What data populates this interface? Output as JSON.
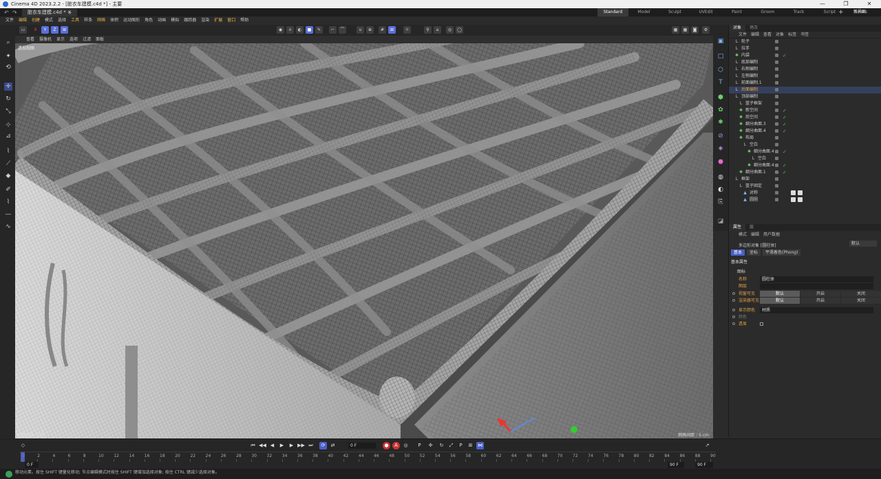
{
  "window": {
    "title": "Cinema 4D 2023.2.2 - [脏衣车建模.c4d *] - 主要"
  },
  "doc_tab": {
    "label": "脏衣车建模.c4d *"
  },
  "layouts": [
    {
      "label": "Standard",
      "active": true
    },
    {
      "label": "Model"
    },
    {
      "label": "Sculpt"
    },
    {
      "label": "UVEdit"
    },
    {
      "label": "Paint"
    },
    {
      "label": "Groom"
    },
    {
      "label": "Track"
    },
    {
      "label": "Script"
    },
    {
      "label": "Nodes"
    }
  ],
  "new_interface": "新界面",
  "menu": [
    "文件",
    "编辑",
    "创建",
    "模式",
    "选择",
    "工具",
    "样条",
    "网格",
    "体积",
    "运动图形",
    "角色",
    "动画",
    "模拟",
    "跟踪器",
    "渲染",
    "扩展",
    "窗口",
    "帮助"
  ],
  "viewport": {
    "menu": [
      "查看",
      "摄像机",
      "显示",
      "选项",
      "过滤",
      "面板"
    ],
    "name": "透视视图",
    "status_left": "查看变换: 工程",
    "status_right": "网格间距 : 5 cm"
  },
  "object_manager": {
    "tabs": [
      "对象",
      "场次"
    ],
    "menu": [
      "文件",
      "编辑",
      "查看",
      "对象",
      "标签",
      "书签"
    ],
    "objects": [
      {
        "name": "轮子",
        "indent": 0,
        "icon": "null"
      },
      {
        "name": "拉手",
        "indent": 0,
        "icon": "null"
      },
      {
        "name": "内袋",
        "indent": 0,
        "icon": "gen",
        "check": true
      },
      {
        "name": "底部编制",
        "indent": 0,
        "icon": "null"
      },
      {
        "name": "右侧编制",
        "indent": 0,
        "icon": "null"
      },
      {
        "name": "左侧编制",
        "indent": 0,
        "icon": "null"
      },
      {
        "name": "前面编制.1",
        "indent": 0,
        "icon": "null"
      },
      {
        "name": "后面编制",
        "indent": 0,
        "icon": "null",
        "highlight": true
      },
      {
        "name": "顶部编制",
        "indent": 0,
        "icon": "null"
      },
      {
        "name": "篮子框架",
        "indent": 1,
        "icon": "null"
      },
      {
        "name": "新空间",
        "indent": 1,
        "icon": "gen",
        "check": true
      },
      {
        "name": "后空间",
        "indent": 1,
        "icon": "gen",
        "check": true
      },
      {
        "name": "细分曲面.3",
        "indent": 1,
        "icon": "gen",
        "check": true
      },
      {
        "name": "细分曲面.4",
        "indent": 1,
        "icon": "gen",
        "check": true
      },
      {
        "name": "布局",
        "indent": 1,
        "icon": "gen"
      },
      {
        "name": "空白",
        "indent": 2,
        "icon": "null"
      },
      {
        "name": "细分曲面.4",
        "indent": 3,
        "icon": "gen",
        "check": true
      },
      {
        "name": "空白",
        "indent": 4,
        "icon": "null"
      },
      {
        "name": "细分曲面.4",
        "indent": 3,
        "icon": "gen",
        "check": true
      },
      {
        "name": "细分曲面.1",
        "indent": 1,
        "icon": "gen",
        "check": true
      },
      {
        "name": "框架",
        "indent": 0,
        "icon": "null"
      },
      {
        "name": "篮子固定",
        "indent": 1,
        "icon": "null"
      },
      {
        "name": "对称",
        "indent": 2,
        "icon": "tri",
        "tags": true
      },
      {
        "name": "圆圈",
        "indent": 2,
        "icon": "tri",
        "tags": true
      }
    ]
  },
  "attributes": {
    "tabs": [
      "属性",
      "层"
    ],
    "menu": [
      "模式",
      "编辑",
      "用户数据"
    ],
    "object_type": "多边形对象 [圆柱体]",
    "mode": "默认",
    "subtabs": [
      {
        "label": "基本",
        "active": true
      },
      {
        "label": "坐标"
      },
      {
        "label": "平滑着色(Phong)"
      }
    ],
    "section": "基本属性",
    "subsection": "图标",
    "name_label": "名称",
    "name_value": "圆柱体",
    "layer_label": "图层",
    "editor_visible": {
      "label": "视窗可见",
      "options": [
        "默认",
        "开启",
        "关闭"
      ]
    },
    "render_visible": {
      "label": "渲染器可见",
      "options": [
        "默认",
        "开启",
        "关闭"
      ]
    },
    "display_color": {
      "label": "显示颜色",
      "value": "材质"
    },
    "color_label": "颜色",
    "xray_label": "透显"
  },
  "timeline": {
    "current_frame": "0 F",
    "start_frame": "0 F",
    "end_frame": "90 F",
    "end_frame2": "90 F",
    "ticks": [
      "0",
      "2",
      "4",
      "6",
      "8",
      "10",
      "12",
      "14",
      "16",
      "18",
      "20",
      "22",
      "24",
      "26",
      "28",
      "30",
      "32",
      "34",
      "36",
      "38",
      "40",
      "42",
      "44",
      "46",
      "48",
      "50",
      "52",
      "54",
      "56",
      "58",
      "60",
      "62",
      "64",
      "66",
      "68",
      "70",
      "72",
      "74",
      "76",
      "78",
      "80",
      "82",
      "84",
      "86",
      "88",
      "90"
    ]
  },
  "status": {
    "text": "移动元素。按住 SHIFT 键量化移动; 节点编辑模式时按住 SHIFT 键增加选择对象; 按住 CTRL 键减少选择对象。"
  },
  "colors": {
    "accent": "#5a6fd8",
    "highlight": "#e0a040",
    "check": "#4ac94a"
  }
}
